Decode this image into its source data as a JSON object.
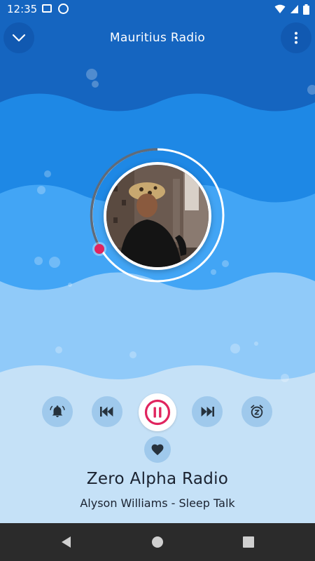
{
  "status_bar": {
    "time": "12:35"
  },
  "header": {
    "title": "Mauritius Radio"
  },
  "player": {
    "station_name": "Zero Alpha Radio",
    "track_info": "Alyson Williams - Sleep Talk",
    "state": "playing"
  },
  "colors": {
    "accent": "#e0245e",
    "header_blue": "#1565c0",
    "wave_light": "#c5e1f7"
  }
}
